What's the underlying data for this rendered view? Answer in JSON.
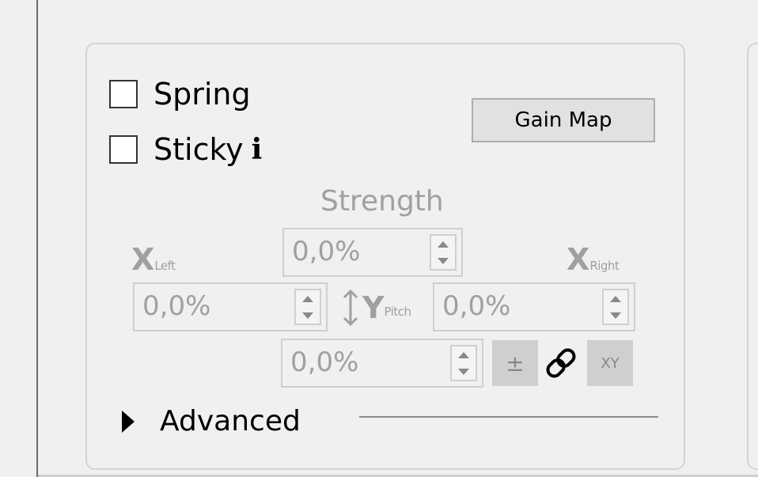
{
  "checkboxes": {
    "spring": {
      "label": "Spring",
      "checked": false
    },
    "sticky": {
      "label": "Sticky",
      "checked": false,
      "info_glyph": "i"
    }
  },
  "gain_map_button": {
    "label": "Gain Map"
  },
  "strength": {
    "label": "Strength",
    "value": "0,0%"
  },
  "x_left": {
    "letter": "X",
    "sub": "Left",
    "value": "0,0%"
  },
  "x_right": {
    "letter": "X",
    "sub": "Right",
    "value": "0,0%"
  },
  "y_pitch": {
    "letter": "Y",
    "sub": "Pitch",
    "value": "0,0%"
  },
  "toggles": {
    "plus_minus": "±",
    "link_icon": "link-icon",
    "xy": "XY"
  },
  "advanced": {
    "label": "Advanced",
    "expanded": false
  },
  "colors": {
    "disabled_text": "#a0a0a0",
    "button_bg": "#e1e1e1",
    "panel_bg": "#f0f0f0"
  }
}
